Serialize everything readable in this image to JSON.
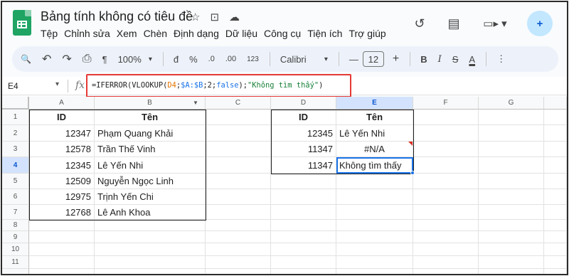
{
  "app": {
    "title": "Bảng tính không có tiêu đề",
    "title_icons": [
      "star-icon",
      "move-to-folder-icon",
      "cloud-status-icon"
    ],
    "title_glyphs": [
      "☆",
      "⊡",
      "☁"
    ]
  },
  "menu": [
    "Tệp",
    "Chỉnh sửa",
    "Xem",
    "Chèn",
    "Định dạng",
    "Dữ liệu",
    "Công cụ",
    "Tiện ích",
    "Trợ giúp"
  ],
  "right_icons": {
    "history_glyph": "↺",
    "comment_glyph": "▤",
    "meet_glyph": "▭▸ ▾",
    "share_glyph": "+"
  },
  "toolbar": {
    "search": "🔍",
    "undo": "↶",
    "redo": "↷",
    "print": "⎙",
    "paint_format": "¶",
    "zoom": "100%",
    "zoom_arrow": "▾",
    "currency": "đ",
    "percent": "%",
    "dec_decrease": ".0",
    "dec_increase": ".00",
    "number_format": "123",
    "font": "Calibri",
    "font_arrow": "▾",
    "minus": "—",
    "font_size": "12",
    "plus": "+",
    "bold": "B",
    "italic": "I",
    "strike": "S",
    "text_color": "A",
    "more": "⋮"
  },
  "formula_bar": {
    "cell_ref": "E4",
    "dropdown": "▾",
    "fx": "fx",
    "f1": "=IFERROR(VLOOKUP(",
    "f2": "D4",
    "f3": ";",
    "f4": "$A:$B",
    "f5": ";2;",
    "f6": "false",
    "f7": ");",
    "f8": "\"Không tìm thấy\"",
    "f9": ")"
  },
  "columns": [
    "A",
    "B",
    "C",
    "D",
    "E",
    "F",
    "G"
  ],
  "rows": [
    "1",
    "2",
    "3",
    "4",
    "5",
    "6",
    "7",
    "8",
    "9",
    "10",
    "11"
  ],
  "table1": {
    "header_id": "ID",
    "header_name": "Tên",
    "rows": [
      {
        "id": "12347",
        "name": "Phạm Quang Khải"
      },
      {
        "id": "12578",
        "name": "Trần Thế Vinh"
      },
      {
        "id": "12345",
        "name": "Lê Yến Nhi"
      },
      {
        "id": "12509",
        "name": "Nguyễn Ngọc Linh"
      },
      {
        "id": "12975",
        "name": "Trịnh Yến Chi"
      },
      {
        "id": "12768",
        "name": "Lê Anh Khoa"
      }
    ]
  },
  "table2": {
    "header_id": "ID",
    "header_name": "Tên",
    "rows": [
      {
        "id": "12345",
        "name": "Lê Yến Nhi"
      },
      {
        "id": "11347",
        "name": "#N/A"
      },
      {
        "id": "11347",
        "name": "Không tìm thấy"
      }
    ]
  },
  "colors": {
    "sheets_green": "#1fa463",
    "selection_blue": "#1a73e8",
    "highlight_red": "#e53935"
  }
}
